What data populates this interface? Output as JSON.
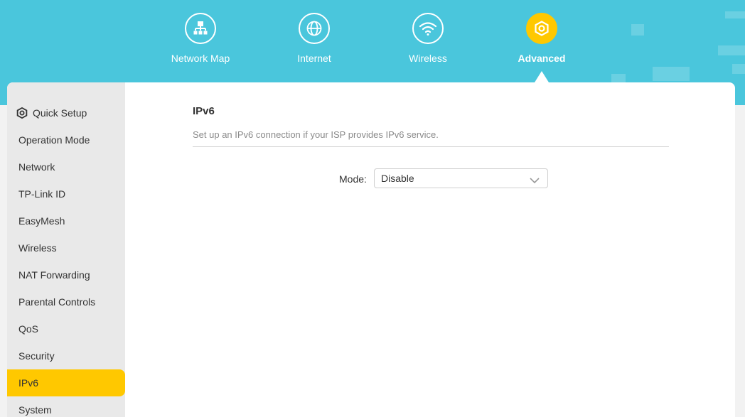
{
  "nav": {
    "items": [
      {
        "label": "Network Map",
        "icon": "network-map-icon"
      },
      {
        "label": "Internet",
        "icon": "globe-icon"
      },
      {
        "label": "Wireless",
        "icon": "wifi-icon"
      },
      {
        "label": "Advanced",
        "icon": "gear-icon",
        "active": true
      }
    ]
  },
  "sidebar": {
    "items": [
      {
        "label": "Quick Setup",
        "icon": "gear-icon"
      },
      {
        "label": "Operation Mode"
      },
      {
        "label": "Network"
      },
      {
        "label": "TP-Link ID"
      },
      {
        "label": "EasyMesh"
      },
      {
        "label": "Wireless"
      },
      {
        "label": "NAT Forwarding"
      },
      {
        "label": "Parental Controls"
      },
      {
        "label": "QoS"
      },
      {
        "label": "Security"
      },
      {
        "label": "IPv6",
        "active": true
      },
      {
        "label": "System"
      }
    ]
  },
  "main": {
    "title": "IPv6",
    "description": "Set up an IPv6 connection if your ISP provides IPv6 service.",
    "mode_label": "Mode:",
    "mode_value": "Disable"
  },
  "colors": {
    "header": "#4ac6dc",
    "accent": "#ffc800",
    "sidebar_bg": "#e9e9e9"
  }
}
